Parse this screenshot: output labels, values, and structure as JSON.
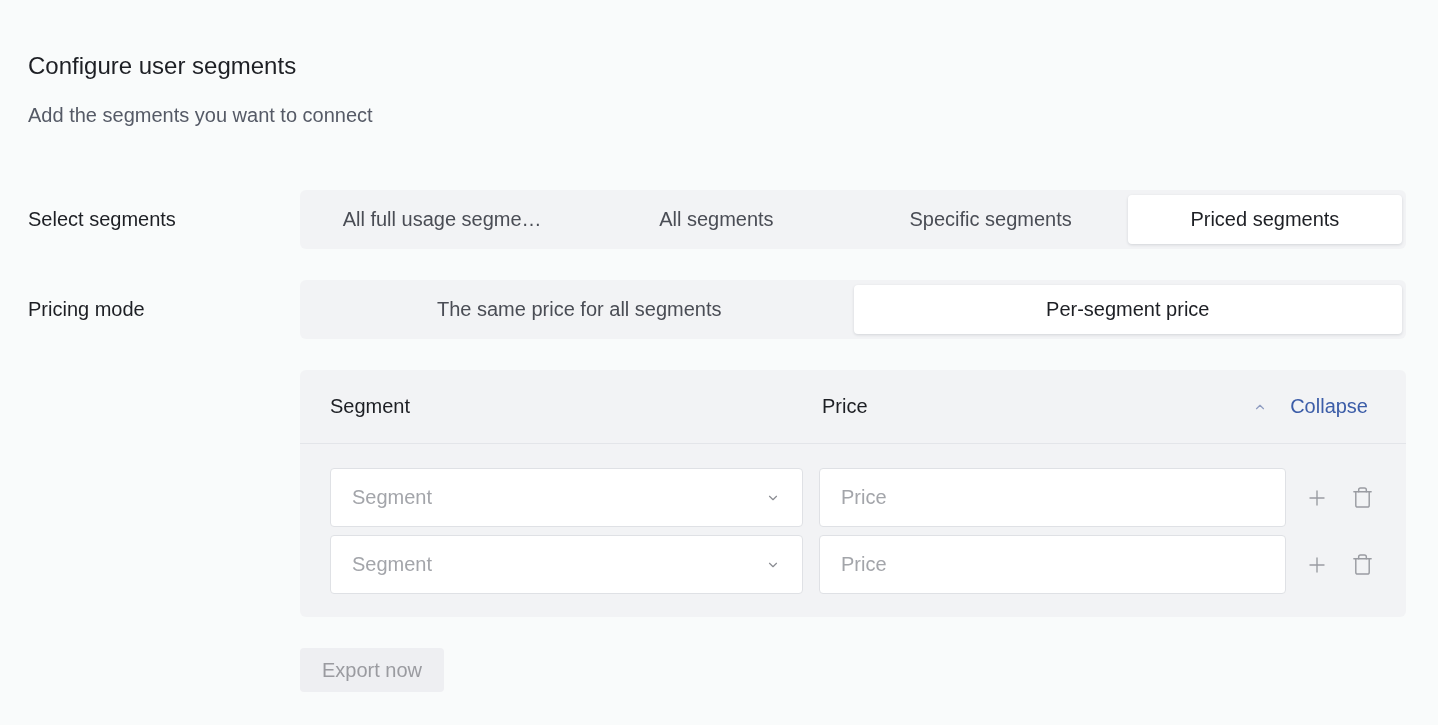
{
  "header": {
    "title": "Configure user segments",
    "subtitle": "Add the segments you want to connect"
  },
  "fields": [
    {
      "label": "Select segments",
      "options": [
        {
          "label": "All full usage segme…",
          "selected": false
        },
        {
          "label": "All segments",
          "selected": false
        },
        {
          "label": "Specific segments",
          "selected": false
        },
        {
          "label": "Priced segments",
          "selected": true
        }
      ]
    },
    {
      "label": "Pricing mode",
      "options": [
        {
          "label": "The same price for all segments",
          "selected": false
        },
        {
          "label": "Per-segment price",
          "selected": true
        }
      ]
    }
  ],
  "segment_table": {
    "columns": [
      "Segment",
      "Price"
    ],
    "collapse_link": "Collapse",
    "expanded": true,
    "rows": [
      {
        "segment": {
          "placeholder": "Segment"
        },
        "price": {
          "placeholder": "Price"
        }
      },
      {
        "segment": {
          "placeholder": "Segment"
        },
        "price": {
          "placeholder": "Price"
        }
      }
    ]
  },
  "export_button": {
    "label": "Export now",
    "disabled": true
  }
}
